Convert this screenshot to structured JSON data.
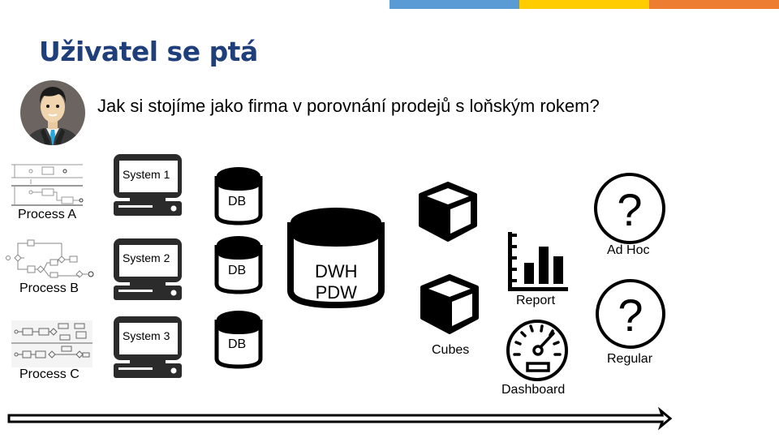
{
  "colors": {
    "title": "#1f3f7a",
    "bar_blue": "#5b9bd5",
    "bar_yellow": "#ffcc00",
    "bar_orange": "#ed7d31",
    "avatar_bg": "#6b6461",
    "tie": "#29a8e0"
  },
  "header": {
    "title": "Uživatel se ptá"
  },
  "question": {
    "avatar_icon": "businessman-avatar-icon",
    "text": "Jak si stojíme jako firma v porovnání prodejů s loňským rokem?"
  },
  "processes": [
    {
      "label": "Process A",
      "icon": "process-diagram-icon"
    },
    {
      "label": "Process B",
      "icon": "process-diagram-icon"
    },
    {
      "label": "Process C",
      "icon": "process-diagram-icon"
    }
  ],
  "systems": [
    {
      "label": "System 1",
      "icon": "computer-icon"
    },
    {
      "label": "System 2",
      "icon": "computer-icon"
    },
    {
      "label": "System 3",
      "icon": "computer-icon"
    }
  ],
  "databases": [
    {
      "label": "DB",
      "icon": "database-icon"
    },
    {
      "label": "DB",
      "icon": "database-icon"
    },
    {
      "label": "DB",
      "icon": "database-icon"
    }
  ],
  "warehouse": {
    "line1": "DWH",
    "line2": "PDW",
    "icon": "database-icon"
  },
  "cubes": {
    "label": "Cubes",
    "icon": "cube-icon"
  },
  "outputs": {
    "report": {
      "label": "Report",
      "icon": "bar-chart-icon"
    },
    "dashboard": {
      "label": "Dashboard",
      "icon": "speedometer-icon"
    },
    "adhoc": {
      "label": "Ad Hoc",
      "icon": "question-circle-icon",
      "glyph": "?"
    },
    "regular": {
      "label": "Regular",
      "icon": "question-circle-icon",
      "glyph": "?"
    }
  },
  "timeline": {
    "icon": "arrow-right-icon"
  }
}
